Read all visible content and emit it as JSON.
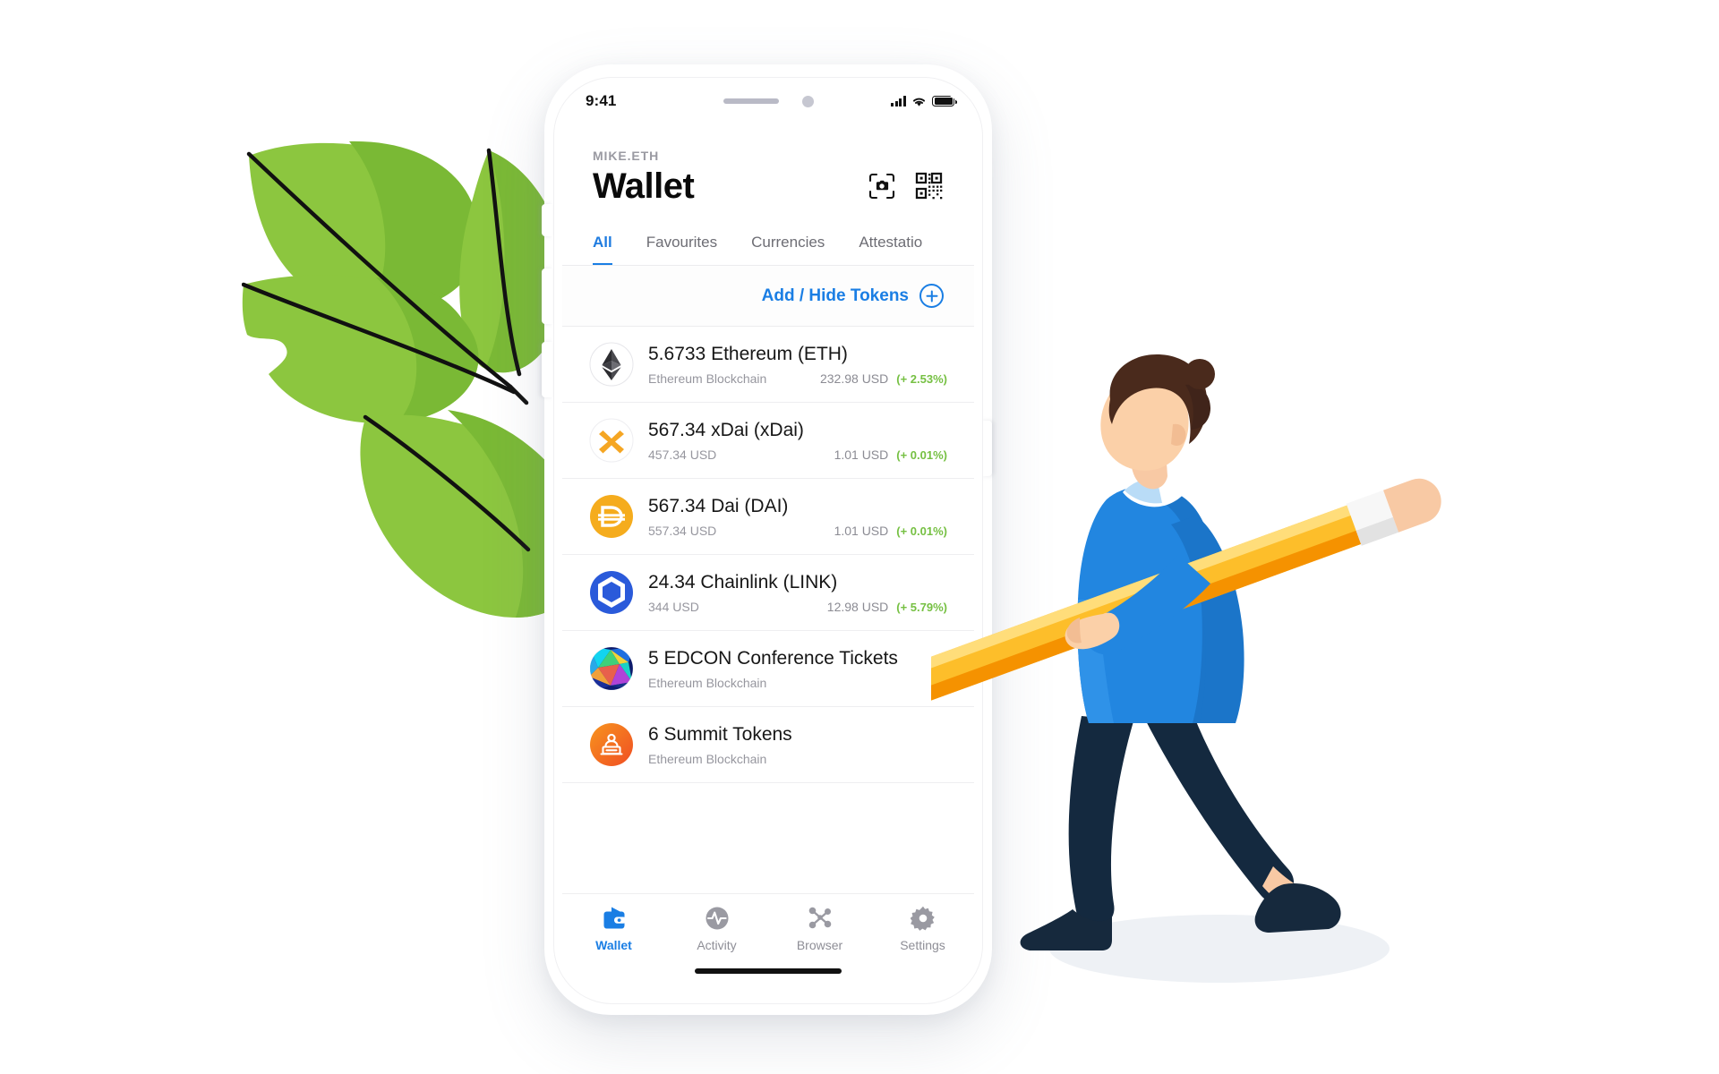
{
  "phone": {
    "status_bar": {
      "time": "9:41",
      "icons": [
        "signal-icon",
        "wifi-icon",
        "battery-icon"
      ]
    },
    "home_indicator": true
  },
  "header": {
    "ens_name": "MIKE.ETH",
    "title": "Wallet",
    "actions": [
      {
        "name": "scan-camera-icon",
        "label": "Scan"
      },
      {
        "name": "qr-code-icon",
        "label": "QR Code"
      }
    ]
  },
  "tabs": {
    "items": [
      {
        "label": "All",
        "active": true
      },
      {
        "label": "Favourites",
        "active": false
      },
      {
        "label": "Currencies",
        "active": false
      },
      {
        "label": "Attestatio",
        "active": false
      }
    ]
  },
  "add_hide": {
    "label": "Add / Hide Tokens",
    "icon": "plus-circle-icon"
  },
  "tokens": [
    {
      "icon": "ethereum-icon",
      "name": "5.6733 Ethereum (ETH)",
      "subtitle": "Ethereum Blockchain",
      "price": "232.98 USD",
      "delta": "(+ 2.53%)"
    },
    {
      "icon": "xdai-icon",
      "name": "567.34 xDai (xDai)",
      "subtitle": "457.34 USD",
      "price": "1.01 USD",
      "delta": "(+ 0.01%)"
    },
    {
      "icon": "dai-icon",
      "name": "567.34 Dai (DAI)",
      "subtitle": "557.34 USD",
      "price": "1.01 USD",
      "delta": "(+ 0.01%)"
    },
    {
      "icon": "chainlink-icon",
      "name": "24.34 Chainlink (LINK)",
      "subtitle": "344 USD",
      "price": "12.98 USD",
      "delta": "(+ 5.79%)"
    },
    {
      "icon": "edcon-ticket-icon",
      "name": "5 EDCON Conference Tickets",
      "subtitle": "Ethereum Blockchain",
      "price": "",
      "delta": ""
    },
    {
      "icon": "summit-token-icon",
      "name": "6 Summit Tokens",
      "subtitle": "Ethereum Blockchain",
      "price": "",
      "delta": ""
    }
  ],
  "bottom_nav": [
    {
      "label": "Wallet",
      "icon": "wallet-icon",
      "active": true
    },
    {
      "label": "Activity",
      "icon": "activity-pulse-icon",
      "active": false
    },
    {
      "label": "Browser",
      "icon": "browser-nodes-icon",
      "active": false
    },
    {
      "label": "Settings",
      "icon": "gear-icon",
      "active": false
    }
  ],
  "colors": {
    "accent_blue": "#1a7ee4",
    "positive_green": "#76c043",
    "text_primary": "#161616",
    "text_muted": "#96969e",
    "leaf_green_light": "#8cc63f",
    "leaf_green_dark": "#6fb034",
    "character_shirt": "#2286e0",
    "character_pants": "#14293f",
    "pencil_yellow": "#fdbe2a"
  },
  "illustration": {
    "leaves": "green-leaves-branch",
    "character": "man-carrying-giant-pencil"
  }
}
